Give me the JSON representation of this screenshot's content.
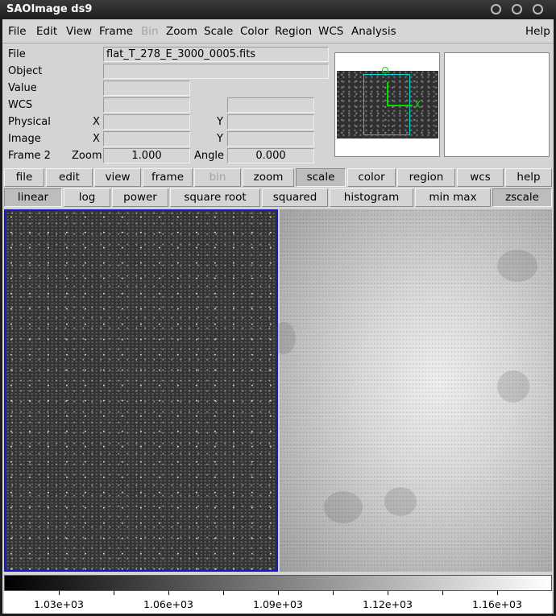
{
  "window": {
    "title": "SAOImage ds9",
    "controls": [
      "circle-button",
      "circle-button",
      "circle-button"
    ]
  },
  "menubar": {
    "items": [
      {
        "label": "File",
        "disabled": false
      },
      {
        "label": "Edit",
        "disabled": false
      },
      {
        "label": "View",
        "disabled": false
      },
      {
        "label": "Frame",
        "disabled": false
      },
      {
        "label": "Bin",
        "disabled": true
      },
      {
        "label": "Zoom",
        "disabled": false
      },
      {
        "label": "Scale",
        "disabled": false
      },
      {
        "label": "Color",
        "disabled": false
      },
      {
        "label": "Region",
        "disabled": false
      },
      {
        "label": "WCS",
        "disabled": false
      },
      {
        "label": "Analysis",
        "disabled": false
      },
      {
        "label": "Help",
        "disabled": false
      }
    ]
  },
  "info": {
    "file_label": "File",
    "file_value": "flat_T_278_E_3000_0005.fits",
    "object_label": "Object",
    "object_value": "",
    "value_label": "Value",
    "value_value": "",
    "wcs_label": "WCS",
    "wcs_value_1": "",
    "wcs_value_2": "",
    "physical_label": "Physical",
    "physical_x_label": "X",
    "physical_x": "",
    "physical_y_label": "Y",
    "physical_y": "",
    "image_label": "Image",
    "image_x_label": "X",
    "image_x": "",
    "image_y_label": "Y",
    "image_y": "",
    "frame_label": "Frame 2",
    "zoom_label": "Zoom",
    "zoom_value": "1.000",
    "angle_label": "Angle",
    "angle_value": "0.000",
    "panner_x_label": "X"
  },
  "buttonbar": {
    "items": [
      {
        "label": "file",
        "active": false,
        "disabled": false
      },
      {
        "label": "edit",
        "active": false,
        "disabled": false
      },
      {
        "label": "view",
        "active": false,
        "disabled": false
      },
      {
        "label": "frame",
        "active": false,
        "disabled": false
      },
      {
        "label": "bin",
        "active": false,
        "disabled": true
      },
      {
        "label": "zoom",
        "active": false,
        "disabled": false
      },
      {
        "label": "scale",
        "active": true,
        "disabled": false
      },
      {
        "label": "color",
        "active": false,
        "disabled": false
      },
      {
        "label": "region",
        "active": false,
        "disabled": false
      },
      {
        "label": "wcs",
        "active": false,
        "disabled": false
      },
      {
        "label": "help",
        "active": false,
        "disabled": false
      }
    ]
  },
  "scalebar": {
    "items": [
      {
        "label": "linear",
        "active": true
      },
      {
        "label": "log",
        "active": false
      },
      {
        "label": "power",
        "active": false
      },
      {
        "label": "square root",
        "active": false
      },
      {
        "label": "squared",
        "active": false
      },
      {
        "label": "histogram",
        "active": false
      },
      {
        "label": "min max",
        "active": false
      },
      {
        "label": "zscale",
        "active": true
      }
    ]
  },
  "colorbar": {
    "ticks": [
      "1.03e+03",
      "1.06e+03",
      "1.09e+03",
      "1.12e+03",
      "1.16e+03"
    ]
  },
  "colors": {
    "current_frame_border": "#1818c8",
    "panner_box": "#00d8d8",
    "compass": "#00e000"
  }
}
